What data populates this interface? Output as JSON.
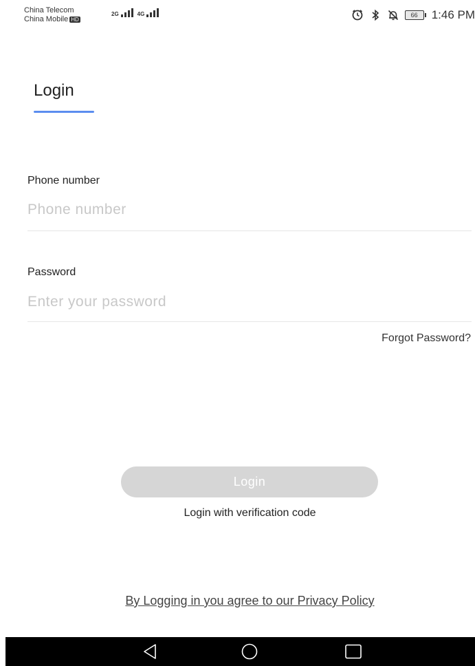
{
  "status_bar": {
    "carrier_1": "China Telecom",
    "carrier_2": "China Mobile",
    "hd_badge": "HD",
    "network_1": "2G",
    "network_2": "4G",
    "battery_level": "66",
    "time": "1:46 PM",
    "icons": [
      "alarm-icon",
      "bluetooth-icon",
      "silent-icon",
      "battery-icon"
    ]
  },
  "page": {
    "title": "Login"
  },
  "form": {
    "phone": {
      "label": "Phone number",
      "placeholder": "Phone number",
      "value": ""
    },
    "password": {
      "label": "Password",
      "placeholder": "Enter your password",
      "value": ""
    },
    "forgot_password": "Forgot Password?"
  },
  "actions": {
    "login_label": "Login",
    "verification_login": "Login with verification code",
    "privacy_policy": "By Logging in you agree to our Privacy Policy"
  },
  "nav_bar": {
    "buttons": [
      "back-icon",
      "home-icon",
      "recents-icon"
    ]
  },
  "colors": {
    "accent": "#5b8def",
    "button_disabled": "#d6d6d6",
    "placeholder": "#c8c8c8",
    "nav_background": "#000000"
  }
}
